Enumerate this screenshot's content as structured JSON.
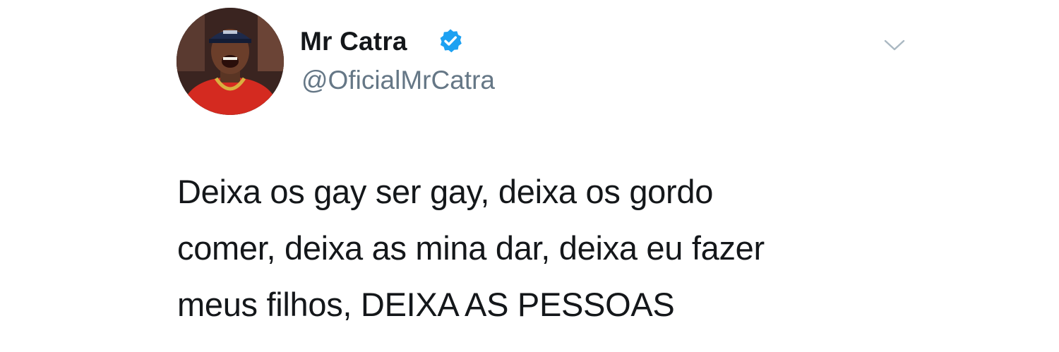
{
  "author": {
    "display_name": "Mr Catra",
    "handle": "@OficialMrCatra",
    "verified": true,
    "avatar_icon": "profile-photo"
  },
  "tweet": {
    "lines": [
      "Deixa os gay ser gay, deixa os gordo",
      "comer, deixa as mina dar, deixa eu fazer",
      "meus filhos, DEIXA AS PESSOAS"
    ]
  },
  "icons": {
    "verified": "verified-badge-icon",
    "menu": "chevron-down-icon"
  },
  "colors": {
    "name": "#14171a",
    "handle": "#657786",
    "verified_badge": "#1da1f2",
    "text": "#14171a",
    "caret": "#aab8c2"
  }
}
